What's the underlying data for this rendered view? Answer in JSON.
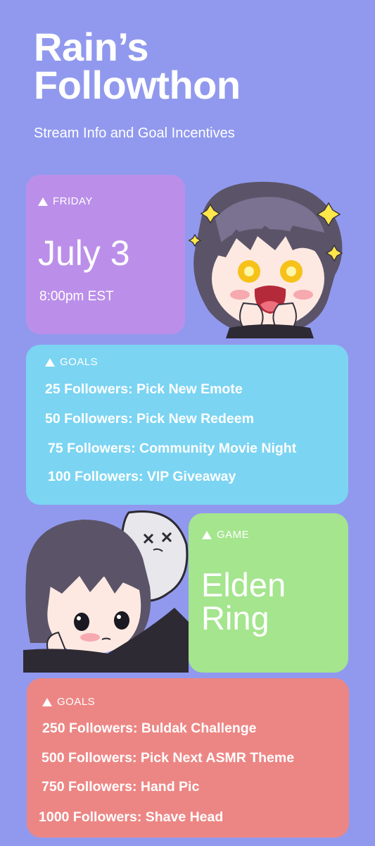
{
  "header": {
    "title_line1": "Rain’s",
    "title_line2": "Followthon",
    "subtitle": "Stream Info and Goal Incentives"
  },
  "date_card": {
    "tag": "FRIDAY",
    "date": "July 3",
    "time": "8:00pm EST"
  },
  "goals_1": {
    "tag": "GOALS",
    "items": [
      "25 Followers: Pick New Emote",
      "50 Followers: Pick New Redeem",
      "75 Followers: Community Movie Night",
      "100 Followers: VIP Giveaway"
    ]
  },
  "game_card": {
    "tag": "GAME",
    "line1": "Elden",
    "line2": "Ring"
  },
  "goals_2": {
    "tag": "GOALS",
    "items": [
      "250 Followers: Buldak Challenge",
      "500 Followers: Pick Next ASMR Theme",
      "750 Followers: Hand Pic",
      "1000 Followers: Shave Head"
    ]
  },
  "colors": {
    "background": "#9199ee",
    "date_card": "#bb8fe9",
    "goals_1": "#7bd4f2",
    "game_card": "#a4e58e",
    "goals_2": "#ec8684"
  },
  "icons": [
    "triangle-up-icon",
    "sparkle-icon"
  ]
}
